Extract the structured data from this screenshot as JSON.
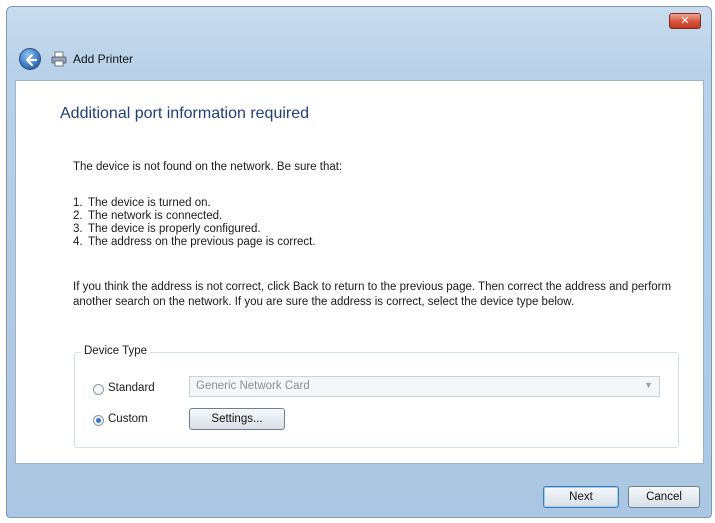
{
  "window": {
    "title": "Add Printer",
    "close_glyph": "✕"
  },
  "page": {
    "heading": "Additional port information required",
    "intro": "The device is not found on the network.  Be sure that:",
    "checklist": [
      {
        "num": "1.",
        "text": "The device is turned on."
      },
      {
        "num": "2.",
        "text": "The network is connected."
      },
      {
        "num": "3.",
        "text": "The device is properly configured."
      },
      {
        "num": "4.",
        "text": "The address on the previous page is correct."
      }
    ],
    "paragraph": "If you think the address is not correct, click Back to return to the previous page.  Then correct the address and perform another search on the network.  If you are sure the address is correct, select the device type below."
  },
  "device_type": {
    "label": "Device Type",
    "standard_label": "Standard",
    "custom_label": "Custom",
    "selected": "Custom",
    "standard_select_value": "Generic Network Card",
    "settings_label": "Settings..."
  },
  "footer": {
    "next_label": "Next",
    "cancel_label": "Cancel"
  },
  "icons": {
    "back": "back-arrow-icon",
    "printer": "printer-icon",
    "close": "close-icon",
    "dropdown": "chevron-down-icon"
  },
  "colors": {
    "heading": "#1e3f78",
    "chrome": "#b9d1e8",
    "close": "#d9573f"
  }
}
